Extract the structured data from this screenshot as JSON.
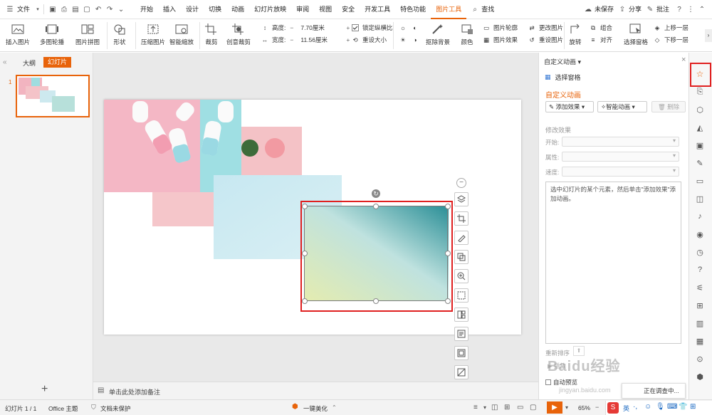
{
  "menubar": {
    "file": "文件",
    "tabs": [
      "开始",
      "插入",
      "设计",
      "切换",
      "动画",
      "幻灯片放映",
      "审阅",
      "视图",
      "安全",
      "开发工具",
      "特色功能",
      "图片工具"
    ],
    "search": "查找",
    "unsaved": "未保存",
    "share": "分享",
    "comment": "批注"
  },
  "ribbon": {
    "insert_pic": "插入图片",
    "multi_outline": "多图轮播",
    "pic_collage": "图片拼图",
    "shape": "形状",
    "compress": "压缩图片",
    "smart_zoom": "智能缩放",
    "crop": "裁剪",
    "creative_crop": "创意裁剪",
    "height_label": "高度:",
    "height_val": "7.70厘米",
    "width_label": "宽度:",
    "width_val": "11.56厘米",
    "lock_ratio": "锁定纵横比",
    "reset_size": "重设大小",
    "remove_bg": "抠除背景",
    "color": "颜色",
    "pic_outline": "图片轮廓",
    "pic_effect": "图片效果",
    "change_pic": "更改图片",
    "reset_pic": "重设图片",
    "rotate": "旋转",
    "group": "组合",
    "align": "对齐",
    "select_pane": "选择窗格",
    "bring_forward": "上移一层",
    "send_backward": "下移一层"
  },
  "left": {
    "tab_outline": "大纲",
    "tab_slides": "幻灯片",
    "slide_num": "1"
  },
  "notes": {
    "placeholder": "单击此处添加备注"
  },
  "right": {
    "header": "自定义动画",
    "select_pane": "选择窗格",
    "section_title": "自定义动画",
    "add_effect": "添加效果",
    "smart_anim": "智能动画",
    "delete": "删除",
    "modify": "修改效果",
    "start": "开始:",
    "property": "属性:",
    "speed": "速度:",
    "hint": "选中幻灯片的某个元素，然后单击\"添加效果\"添加动画。",
    "reorder": "重新排序",
    "autopreview": "自动预览",
    "play": "播放",
    "watermark": "Baidu经验",
    "watermark_url": "jingyan.baidu.com",
    "toast": "正在调查中..."
  },
  "status": {
    "slide_info": "幻灯片 1 / 1",
    "theme": "Office 主题",
    "doc_protect": "文档未保护",
    "beautify": "一键美化",
    "zoom": "65%"
  },
  "colors": {
    "accent": "#e8630a",
    "highlight": "#e02020"
  }
}
